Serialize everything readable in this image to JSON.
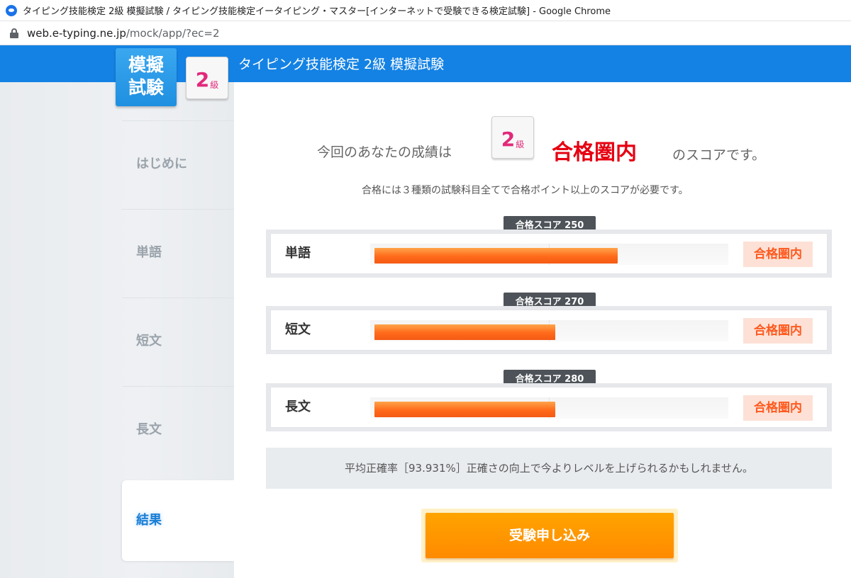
{
  "browser": {
    "title": "タイピング技能検定 2級 模擬試験 / タイピング技能検定イータイピング・マスター[インターネットで受験できる検定試験] - Google Chrome",
    "url_host": "web.e-typing.ne.jp",
    "url_path": "/mock/app/?ec=2"
  },
  "header": {
    "mock_line1": "模擬",
    "mock_line2": "試験",
    "grade_num": "2",
    "grade_kyu": "級",
    "title": "タイピング技能検定 2級 模擬試験"
  },
  "sidebar": {
    "items": [
      {
        "label": "はじめに"
      },
      {
        "label": "単語"
      },
      {
        "label": "短文"
      },
      {
        "label": "長文"
      },
      {
        "label": "結果"
      }
    ]
  },
  "result": {
    "prefix": "今回のあなたの成績は",
    "grade_num": "2",
    "grade_kyu": "級",
    "status": "合格圏内",
    "suffix": "のスコアです。",
    "note": "合格には３種類の試験科目全てで合格ポイント以上のスコアが必要です。"
  },
  "scores": [
    {
      "subject": "単語",
      "pass_label": "合格スコア 250",
      "fill_fraction": 0.68,
      "status": "合格圏内"
    },
    {
      "subject": "短文",
      "pass_label": "合格スコア 270",
      "fill_fraction": 0.505,
      "status": "合格圏内"
    },
    {
      "subject": "長文",
      "pass_label": "合格スコア 280",
      "fill_fraction": 0.505,
      "status": "合格圏内"
    }
  ],
  "accuracy": "平均正確率［93.931%］正確さの向上で今よりレベルを上げられるかもしれません。",
  "apply_button": "受験申し込み",
  "colors": {
    "header_blue": "#1482e4",
    "pass_red": "#e60012",
    "bar_orange": "#ff6a1a",
    "button_orange": "#ff9800",
    "grade_pink": "#e2297a"
  }
}
